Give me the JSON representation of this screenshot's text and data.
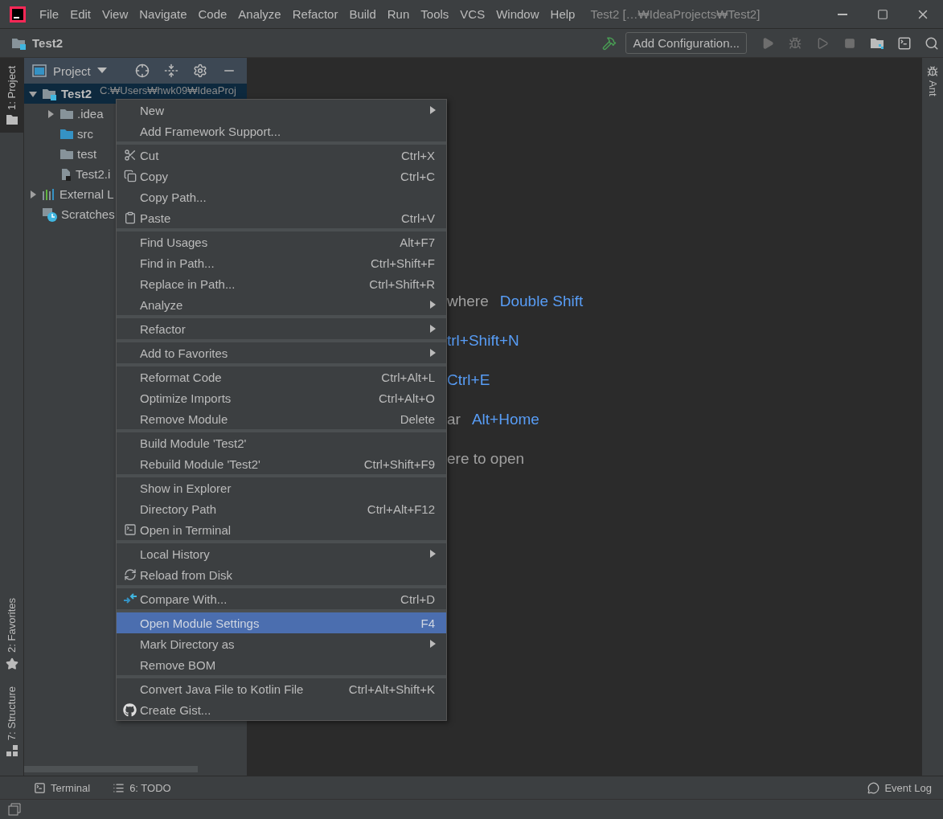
{
  "window": {
    "title": "Test2 […₩IdeaProjects₩Test2]"
  },
  "menu_bar": [
    "File",
    "Edit",
    "View",
    "Navigate",
    "Code",
    "Analyze",
    "Refactor",
    "Build",
    "Run",
    "Tools",
    "VCS",
    "Window",
    "Help"
  ],
  "nav_bar": {
    "breadcrumb": "Test2",
    "run_config": "Add Configuration..."
  },
  "left_stripe": [
    {
      "label": "1: Project",
      "selected": true
    },
    {
      "label": "2: Favorites",
      "selected": false
    },
    {
      "label": "7: Structure",
      "selected": false
    }
  ],
  "right_stripe": [
    {
      "label": "Ant"
    }
  ],
  "project_panel": {
    "title": "Project",
    "tree": [
      {
        "label": "Test2",
        "detail": "C:₩Users₩hwk09₩IdeaProj",
        "kind": "module",
        "expanded": true,
        "selected": true,
        "children": [
          {
            "label": ".idea",
            "kind": "folder",
            "expanded": false,
            "selected": false
          },
          {
            "label": "src",
            "kind": "source",
            "selected": false
          },
          {
            "label": "test",
            "kind": "folder",
            "selected": false
          },
          {
            "label": "Test2.i",
            "kind": "file",
            "selected": false
          }
        ]
      },
      {
        "label": "External L",
        "kind": "library",
        "expanded": false,
        "selected": false
      },
      {
        "label": "Scratches",
        "kind": "scratch",
        "selected": false
      }
    ]
  },
  "editor_hints": [
    {
      "text": "where",
      "shortcut": "Double Shift"
    },
    {
      "shortcut": "trl+Shift+N"
    },
    {
      "shortcut": "Ctrl+E"
    },
    {
      "text": "ar",
      "shortcut": "Alt+Home"
    },
    {
      "text": "ere to open"
    }
  ],
  "context_menu": {
    "groups": [
      {
        "items": [
          {
            "label": "New",
            "submenu": true,
            "selected": false
          },
          {
            "label": "Add Framework Support...",
            "submenu": false,
            "selected": false
          }
        ]
      },
      {
        "items": [
          {
            "label": "Cut",
            "shortcut": "Ctrl+X",
            "submenu": false,
            "selected": false
          },
          {
            "label": "Copy",
            "shortcut": "Ctrl+C",
            "submenu": false,
            "selected": false
          },
          {
            "label": "Copy Path...",
            "submenu": false,
            "selected": false
          },
          {
            "label": "Paste",
            "shortcut": "Ctrl+V",
            "submenu": false,
            "selected": false
          }
        ]
      },
      {
        "items": [
          {
            "label": "Find Usages",
            "shortcut": "Alt+F7",
            "submenu": false,
            "selected": false
          },
          {
            "label": "Find in Path...",
            "shortcut": "Ctrl+Shift+F",
            "submenu": false,
            "selected": false
          },
          {
            "label": "Replace in Path...",
            "shortcut": "Ctrl+Shift+R",
            "submenu": false,
            "selected": false
          },
          {
            "label": "Analyze",
            "submenu": true,
            "selected": false
          }
        ]
      },
      {
        "items": [
          {
            "label": "Refactor",
            "submenu": true,
            "selected": false
          }
        ]
      },
      {
        "items": [
          {
            "label": "Add to Favorites",
            "submenu": true,
            "selected": false
          }
        ]
      },
      {
        "items": [
          {
            "label": "Reformat Code",
            "shortcut": "Ctrl+Alt+L",
            "submenu": false,
            "selected": false
          },
          {
            "label": "Optimize Imports",
            "shortcut": "Ctrl+Alt+O",
            "submenu": false,
            "selected": false
          },
          {
            "label": "Remove Module",
            "shortcut": "Delete",
            "submenu": false,
            "selected": false
          }
        ]
      },
      {
        "items": [
          {
            "label": "Build Module 'Test2'",
            "submenu": false,
            "selected": false
          },
          {
            "label": "Rebuild Module 'Test2'",
            "shortcut": "Ctrl+Shift+F9",
            "submenu": false,
            "selected": false
          }
        ]
      },
      {
        "items": [
          {
            "label": "Show in Explorer",
            "submenu": false,
            "selected": false
          },
          {
            "label": "Directory Path",
            "shortcut": "Ctrl+Alt+F12",
            "submenu": false,
            "selected": false
          },
          {
            "label": "Open in Terminal",
            "submenu": false,
            "selected": false
          }
        ]
      },
      {
        "items": [
          {
            "label": "Local History",
            "submenu": true,
            "selected": false
          },
          {
            "label": "Reload from Disk",
            "submenu": false,
            "selected": false
          }
        ]
      },
      {
        "items": [
          {
            "label": "Compare With...",
            "shortcut": "Ctrl+D",
            "submenu": false,
            "selected": false
          }
        ]
      },
      {
        "items": [
          {
            "label": "Open Module Settings",
            "shortcut": "F4",
            "submenu": false,
            "selected": true
          },
          {
            "label": "Mark Directory as",
            "submenu": true,
            "selected": false
          },
          {
            "label": "Remove BOM",
            "submenu": false,
            "selected": false
          }
        ]
      },
      {
        "items": [
          {
            "label": "Convert Java File to Kotlin File",
            "shortcut": "Ctrl+Alt+Shift+K",
            "submenu": false,
            "selected": false
          },
          {
            "label": "Create Gist...",
            "submenu": false,
            "selected": false
          }
        ]
      }
    ]
  },
  "bottom_bar": {
    "tools": [
      "Terminal",
      "6: TODO"
    ],
    "event_log": "Event Log"
  }
}
